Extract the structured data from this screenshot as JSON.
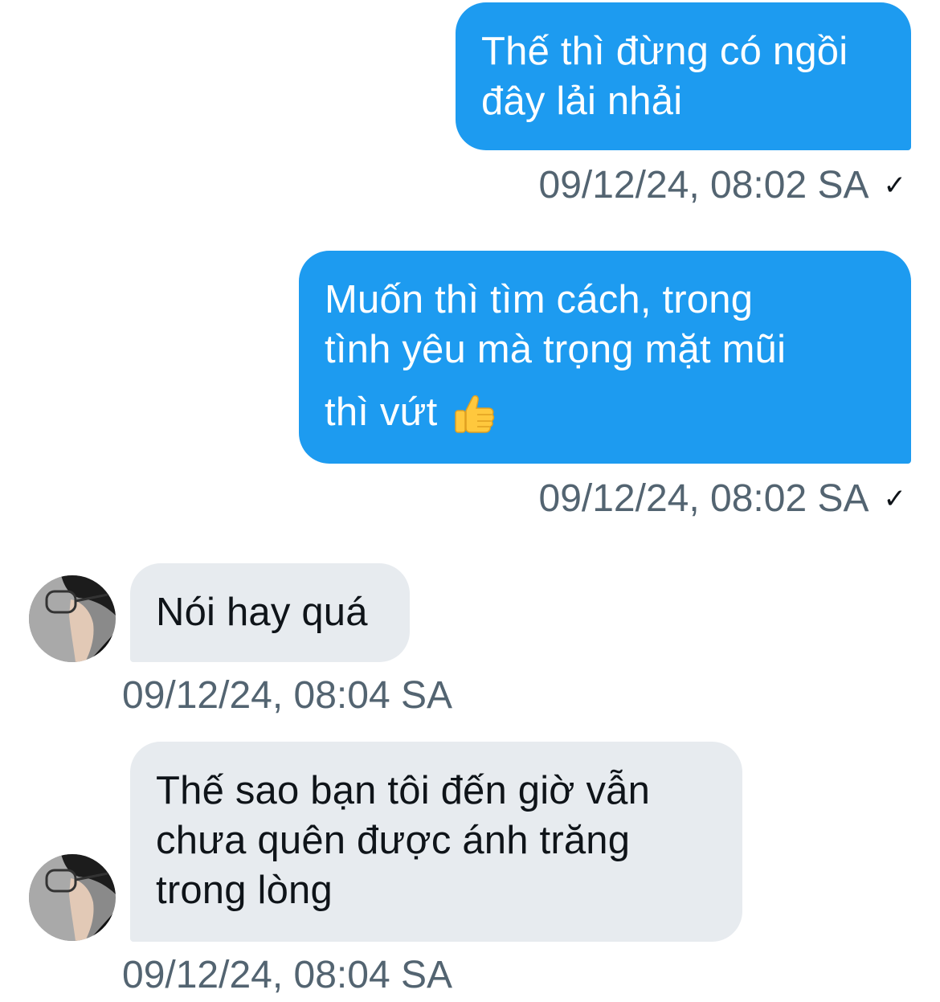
{
  "messages": [
    {
      "direction": "outgoing",
      "lines": [
        "Thế thì đừng có ngồi",
        "đây lải nhải"
      ],
      "timestamp": "09/12/24, 08:02 SA",
      "status_icon": "check-icon"
    },
    {
      "direction": "outgoing",
      "lines": [
        "Muốn thì tìm cách, trong",
        "tình yêu mà trọng mặt mũi",
        "thì vứt"
      ],
      "emoji": "thumbs-up-icon",
      "timestamp": "09/12/24, 08:02 SA",
      "status_icon": "check-icon"
    },
    {
      "direction": "incoming",
      "lines": [
        "Nói hay quá"
      ],
      "timestamp": "09/12/24, 08:04 SA"
    },
    {
      "direction": "incoming",
      "lines": [
        "Thế sao bạn tôi đến giờ vẫn",
        "chưa quên được ánh trăng",
        "trong lòng"
      ],
      "timestamp": "09/12/24, 08:04 SA"
    }
  ],
  "colors": {
    "outgoing_bubble": "#1d9bf0",
    "incoming_bubble": "#e7ebef",
    "timestamp_text": "#536471"
  },
  "status_check_glyph": "✓"
}
